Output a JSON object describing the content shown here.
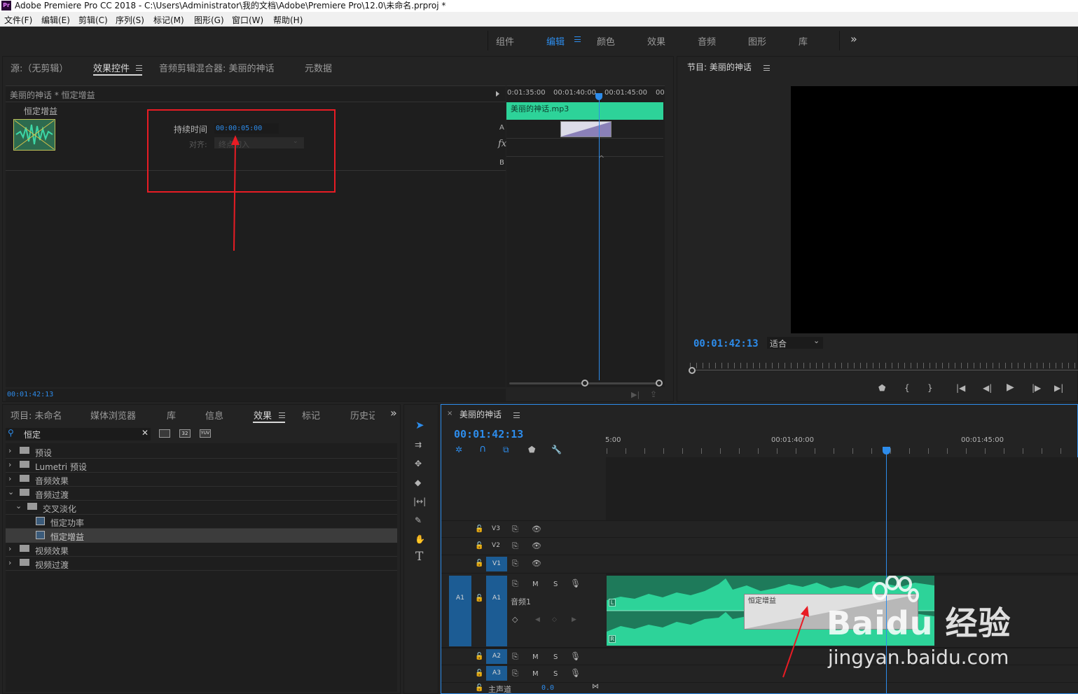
{
  "app": {
    "logo_text": "Pr",
    "window_title": "Adobe Premiere Pro CC 2018 - C:\\Users\\Administrator\\我的文档\\Adobe\\Premiere Pro\\12.0\\未命名.prproj *"
  },
  "menu": [
    "文件(F)",
    "编辑(E)",
    "剪辑(C)",
    "序列(S)",
    "标记(M)",
    "图形(G)",
    "窗口(W)",
    "帮助(H)"
  ],
  "workspaces": {
    "tabs": [
      "组件",
      "编辑",
      "颜色",
      "效果",
      "音频",
      "图形",
      "库"
    ],
    "active": "编辑",
    "overflow": "»"
  },
  "source_panel": {
    "tabs": [
      "源:（无剪辑）",
      "效果控件",
      "音频剪辑混合器: 美丽的神话",
      "元数据"
    ],
    "active_tab": "效果控件",
    "clip_header": "美丽的神话 * 恒定增益",
    "effect_name": "恒定增益",
    "duration_label": "持续时间",
    "duration_value": "00:00:05:00",
    "align_label": "对齐:",
    "align_value": "终点切入",
    "mini_ruler": [
      "0:01:35:00",
      "00:01:40:00",
      "00:01:45:00",
      "00"
    ],
    "mini_clip_name": "美丽的神话.mp3",
    "track_a": "A",
    "track_b": "B",
    "fx_label": "fx",
    "timecode": "00:01:42:13"
  },
  "program_panel": {
    "title": "节目: 美丽的神话",
    "timecode": "00:01:42:13",
    "fit_label": "适合"
  },
  "project_panel": {
    "tabs": [
      "项目: 未命名",
      "媒体浏览器",
      "库",
      "信息",
      "效果",
      "标记",
      "历史记"
    ],
    "active_tab": "效果",
    "overflow": "»",
    "search_value": "恒定",
    "filter_badges": [
      "32",
      "YUV"
    ],
    "tree": [
      {
        "label": "预设",
        "expanded": false,
        "level": 0,
        "kind": "folder-star"
      },
      {
        "label": "Lumetri 预设",
        "expanded": false,
        "level": 0,
        "kind": "folder-star"
      },
      {
        "label": "音频效果",
        "expanded": false,
        "level": 0,
        "kind": "folder"
      },
      {
        "label": "音频过渡",
        "expanded": true,
        "level": 0,
        "kind": "folder"
      },
      {
        "label": "交叉淡化",
        "expanded": true,
        "level": 1,
        "kind": "folder"
      },
      {
        "label": "恒定功率",
        "level": 2,
        "kind": "effect"
      },
      {
        "label": "恒定增益",
        "level": 2,
        "kind": "effect",
        "selected": true
      },
      {
        "label": "视频效果",
        "expanded": false,
        "level": 0,
        "kind": "folder"
      },
      {
        "label": "视频过渡",
        "expanded": false,
        "level": 0,
        "kind": "folder"
      }
    ]
  },
  "timeline": {
    "sequence_name": "美丽的神话",
    "timecode": "00:01:42:13",
    "ruler_labels": [
      "5:00",
      "00:01:40:00",
      "00:01:45:00"
    ],
    "tracks": {
      "v3": "V3",
      "v2": "V2",
      "v1": "V1",
      "a1_source": "A1",
      "a1": "A1",
      "a1_name": "音频1",
      "a2": "A2",
      "a3": "A3",
      "master": "主声道",
      "master_value": "0.0",
      "mute": "M",
      "solo": "S"
    },
    "clip_channel_l": "L",
    "clip_channel_r": "R",
    "transition_label": "恒定增益"
  },
  "watermark": {
    "brand": "Baidu 经验",
    "url": "jingyan.baidu.com"
  },
  "colors": {
    "accent_blue": "#2d8ceb",
    "audio_clip": "#2dd399",
    "audio_clip_dark": "#1e7a5a",
    "annotation_red": "#e81c24",
    "track_target": "#1c5c94"
  }
}
